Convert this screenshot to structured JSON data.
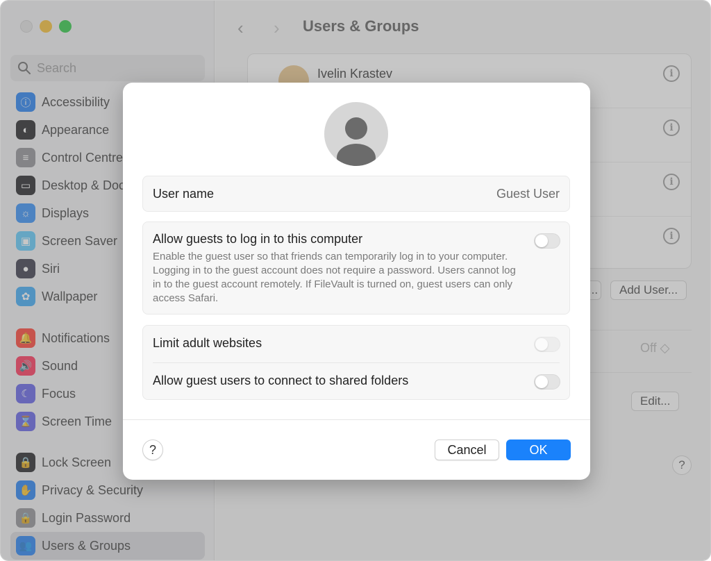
{
  "sidebar": {
    "search_placeholder": "Search",
    "groups": [
      [
        {
          "label": "Accessibility",
          "icon": "accessibility-icon",
          "color": "#1e7cf2",
          "glyph": "ⓘ"
        },
        {
          "label": "Appearance",
          "icon": "appearance-icon",
          "color": "#1d1d1f",
          "glyph": "◐"
        },
        {
          "label": "Control Centre",
          "icon": "control-centre-icon",
          "color": "#8e8e93",
          "glyph": "≡"
        },
        {
          "label": "Desktop & Dock",
          "icon": "desktop-dock-icon",
          "color": "#1d1d1f",
          "glyph": "▭"
        },
        {
          "label": "Displays",
          "icon": "displays-icon",
          "color": "#2f8cf6",
          "glyph": "☼"
        },
        {
          "label": "Screen Saver",
          "icon": "screen-saver-icon",
          "color": "#5ac8fa",
          "glyph": "▣"
        },
        {
          "label": "Siri",
          "icon": "siri-icon",
          "color": "#333344",
          "glyph": "●"
        },
        {
          "label": "Wallpaper",
          "icon": "wallpaper-icon",
          "color": "#38a7f5",
          "glyph": "✿"
        }
      ],
      [
        {
          "label": "Notifications",
          "icon": "notifications-icon",
          "color": "#ff3b30",
          "glyph": "🔔"
        },
        {
          "label": "Sound",
          "icon": "sound-icon",
          "color": "#ff2d55",
          "glyph": "🔊"
        },
        {
          "label": "Focus",
          "icon": "focus-icon",
          "color": "#5e5ce6",
          "glyph": "☾"
        },
        {
          "label": "Screen Time",
          "icon": "screen-time-icon",
          "color": "#5e5ce6",
          "glyph": "⌛"
        }
      ],
      [
        {
          "label": "Lock Screen",
          "icon": "lock-screen-icon",
          "color": "#1d1d1f",
          "glyph": "🔒"
        },
        {
          "label": "Privacy & Security",
          "icon": "privacy-security-icon",
          "color": "#1e7cf2",
          "glyph": "✋"
        },
        {
          "label": "Login Password",
          "icon": "login-password-icon",
          "color": "#8e8e93",
          "glyph": "🔒"
        },
        {
          "label": "Users & Groups",
          "icon": "users-groups-icon",
          "color": "#1e7cf2",
          "glyph": "👥",
          "active": true
        }
      ]
    ]
  },
  "main": {
    "title": "Users & Groups",
    "first_user_name": "Ivelin Krastev",
    "add_user_label": "Add User...",
    "partial_button_label": "...",
    "off_label": "Off ◇",
    "edit_label": "Edit...",
    "help_label": "?"
  },
  "dialog": {
    "username_label": "User name",
    "username_value": "Guest User",
    "allow_title": "Allow guests to log in to this computer",
    "allow_desc": "Enable the guest user so that friends can temporarily log in to your computer. Logging in to the guest account does not require a password. Users cannot log in to the guest account remotely. If FileVault is turned on, guest users can only access Safari.",
    "limit_label": "Limit adult websites",
    "shared_label": "Allow guest users to connect to shared folders",
    "help_label": "?",
    "cancel_label": "Cancel",
    "ok_label": "OK",
    "toggles": {
      "allow_guests": false,
      "limit_adult": false,
      "shared_folders": false
    }
  },
  "colors": {
    "accent": "#1a82fb"
  }
}
